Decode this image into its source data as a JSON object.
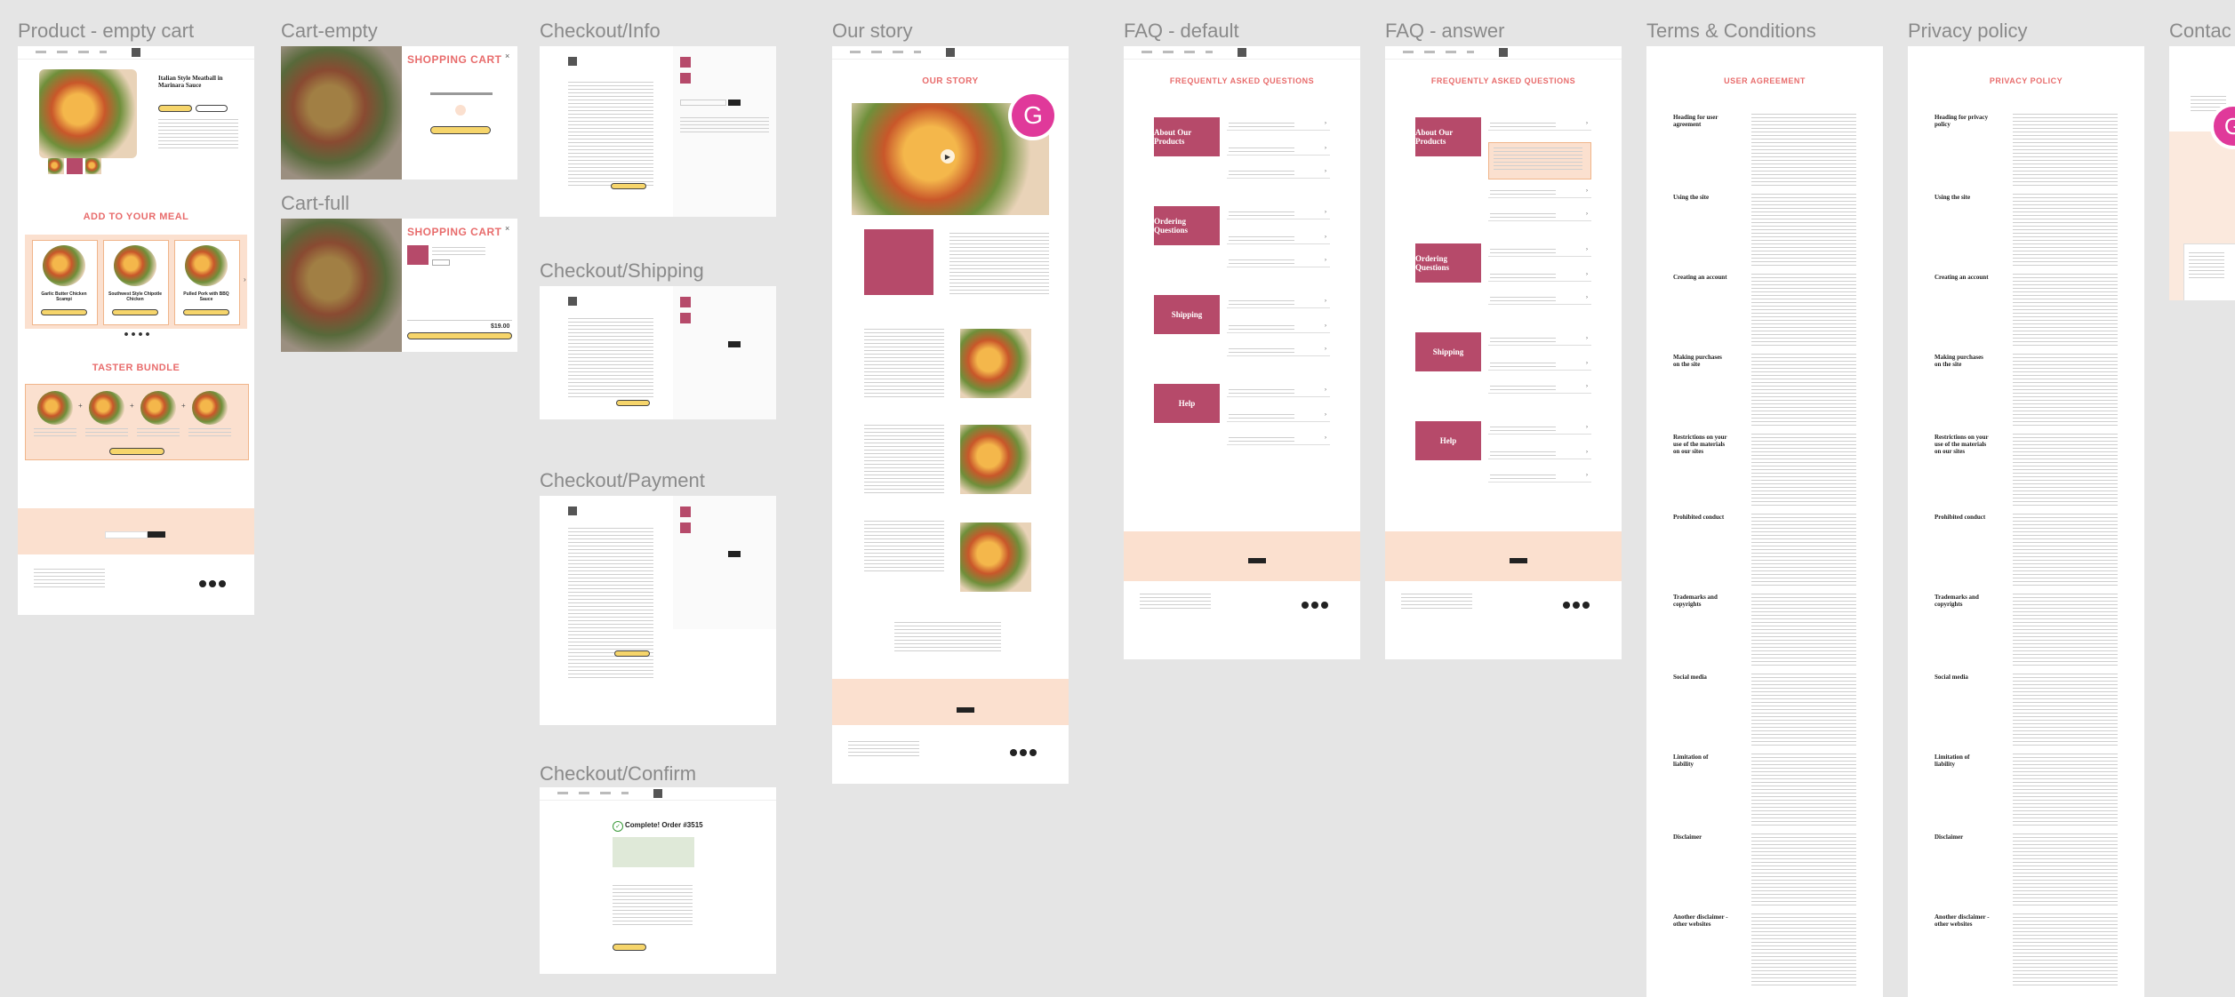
{
  "frames": {
    "product_empty": {
      "title": "Product - empty cart",
      "product_name": "Italian Style Meatball in Marinara Sauce",
      "add_to_meal": "ADD TO YOUR MEAL",
      "taster_bundle": "TASTER BUNDLE",
      "cards": [
        "Garlic Butter Chicken Scampi",
        "Southwest Style Chipotle Chicken",
        "Pulled Pork with BBQ Sauce"
      ]
    },
    "cart_empty": {
      "title": "Cart-empty",
      "heading": "SHOPPING CART"
    },
    "cart_full": {
      "title": "Cart-full",
      "heading": "SHOPPING CART",
      "total": "$19.00"
    },
    "checkout_info": {
      "title": "Checkout/Info"
    },
    "checkout_shipping": {
      "title": "Checkout/Shipping"
    },
    "checkout_payment": {
      "title": "Checkout/Payment"
    },
    "checkout_confirm": {
      "title": "Checkout/Confirm",
      "heading": "Complete! Order #3515"
    },
    "our_story": {
      "title": "Our story",
      "heading": "OUR STORY",
      "avatar_letter": "G"
    },
    "faq_default": {
      "title": "FAQ - default",
      "heading": "FREQUENTLY ASKED QUESTIONS",
      "categories": [
        "About Our Products",
        "Ordering Questions",
        "Shipping",
        "Help"
      ]
    },
    "faq_answer": {
      "title": "FAQ - answer",
      "heading": "FREQUENTLY ASKED QUESTIONS",
      "categories": [
        "About Our Products",
        "Ordering Questions",
        "Shipping",
        "Help"
      ]
    },
    "terms": {
      "title": "Terms & Conditions",
      "heading": "USER AGREEMENT",
      "sections": [
        "Heading for user agreement",
        "Using the site",
        "Creating an account",
        "Making purchases on the site",
        "Restrictions on your use of the materials on our sites",
        "Prohibited conduct",
        "Trademarks and copyrights",
        "Social media",
        "Limitation of liability",
        "Disclaimer",
        "Another disclaimer - other websites"
      ]
    },
    "privacy": {
      "title": "Privacy policy",
      "heading": "PRIVACY POLICY",
      "sections": [
        "Heading for privacy policy",
        "Using the site",
        "Creating an account",
        "Making purchases on the site",
        "Restrictions on your use of the materials on our sites",
        "Prohibited conduct",
        "Trademarks and copyrights",
        "Social media",
        "Limitation of liability",
        "Disclaimer",
        "Another disclaimer - other websites"
      ]
    },
    "contact": {
      "title": "Contac",
      "avatar_letter": "G"
    }
  },
  "colors": {
    "accent_pink": "#e86c6c",
    "faq_maroon": "#b64a6a",
    "peach": "#fbe0cf",
    "button_yellow": "#f6d56b",
    "avatar_pink": "#e0399a"
  }
}
